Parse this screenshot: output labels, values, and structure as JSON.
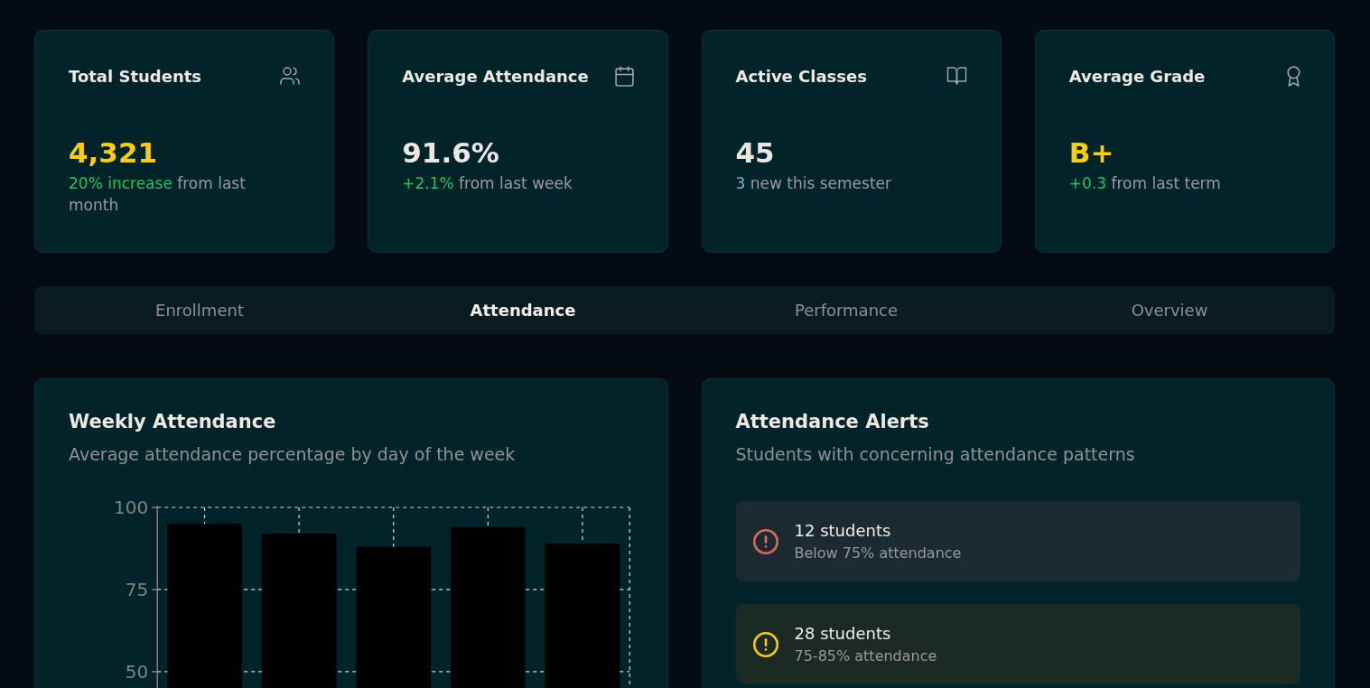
{
  "stats": [
    {
      "title": "Total Students",
      "value": {
        "text": "4,321",
        "color": "#facc15"
      },
      "change": {
        "highlight": "20% increase",
        "color": "#22c55e",
        "text": "from last month"
      }
    },
    {
      "title": "Average Attendance",
      "value": {
        "text": "91.6%",
        "color": "#ebe8e3"
      },
      "change": {
        "highlight": "+2.1%",
        "color": "#22c55e",
        "text": "from last week"
      }
    },
    {
      "title": "Active Classes",
      "value": {
        "text": "45",
        "color": "#ebe8e3"
      },
      "change": {
        "highlight": "3",
        "color": "#7cb4d4",
        "text": "new this semester"
      }
    },
    {
      "title": "Average Grade",
      "value": {
        "text": "B+",
        "color": "#facc15"
      },
      "change": {
        "highlight": "+0.3",
        "color": "#22c55e",
        "text": "from last term"
      }
    }
  ],
  "tabs": [
    {
      "label": "Enrollment",
      "selected": false
    },
    {
      "label": "Attendance",
      "selected": true
    },
    {
      "label": "Performance",
      "selected": false
    },
    {
      "label": "Overview",
      "selected": false
    }
  ],
  "weekly_attendance": {
    "title": "Weekly Attendance",
    "subtitle": "Average attendance percentage by day of the week",
    "chart_data": {
      "type": "bar",
      "values": [
        95,
        92,
        88,
        94,
        89
      ],
      "ylim": [
        45,
        100
      ],
      "yticks": [
        50,
        75,
        100
      ],
      "grid": true
    }
  },
  "attendance_alerts": {
    "title": "Attendance Alerts",
    "subtitle": "Students with concerning attendance patterns",
    "alerts": [
      {
        "kind": "danger",
        "title": "12 students",
        "detail": "Below 75% attendance"
      },
      {
        "kind": "warning",
        "title": "28 students",
        "detail": "75-85% attendance"
      }
    ]
  }
}
